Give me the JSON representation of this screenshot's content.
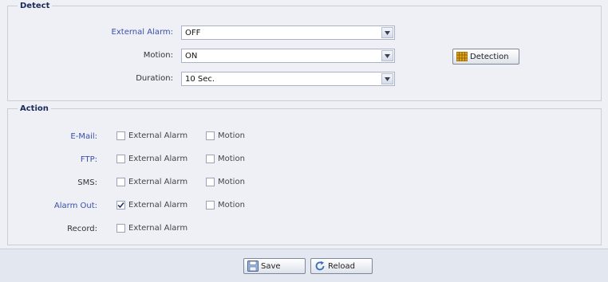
{
  "detect": {
    "legend": "Detect",
    "external_alarm": {
      "label": "External Alarm:",
      "value": "OFF"
    },
    "motion": {
      "label": "Motion:",
      "value": "ON"
    },
    "duration": {
      "label": "Duration:",
      "value": "10 Sec."
    },
    "detection_button": "Detection"
  },
  "action": {
    "legend": "Action",
    "opt_external": "External Alarm",
    "opt_motion": "Motion",
    "rows": [
      {
        "label": "E-Mail:",
        "external_checked": false,
        "motion_checked": false
      },
      {
        "label": "FTP:",
        "external_checked": false,
        "motion_checked": false
      },
      {
        "label": "SMS:",
        "external_checked": false,
        "motion_checked": false
      },
      {
        "label": "Alarm Out:",
        "external_checked": true,
        "motion_checked": false
      },
      {
        "label": "Record:",
        "external_checked": false
      }
    ]
  },
  "footer": {
    "save_label": "Save",
    "reload_label": "Reload"
  },
  "colors": {
    "background": "#eef0f6",
    "label_blue": "#3a4fa8",
    "legend": "#1c2a5a"
  },
  "icons": {
    "select_arrow": "chevron-down-icon",
    "detection": "grid-icon",
    "save": "floppy-disk-icon",
    "reload": "refresh-icon"
  }
}
